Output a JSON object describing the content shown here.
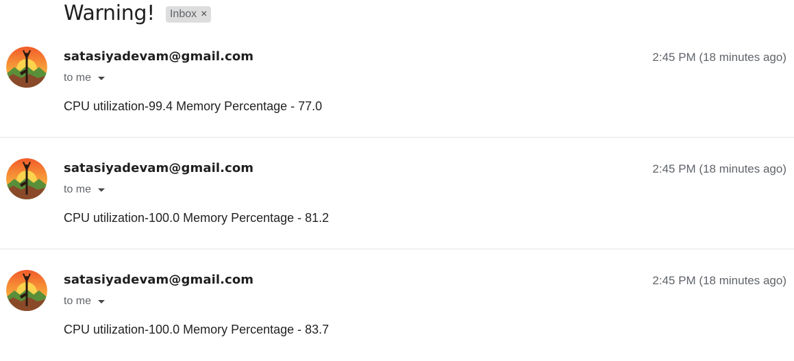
{
  "thread": {
    "subject": "Warning!",
    "label": "Inbox",
    "label_remove_glyph": "×"
  },
  "messages": [
    {
      "sender": "satasiyadevam@gmail.com",
      "recipient": "to me",
      "time": "2:45 PM (18 minutes ago)",
      "body": "CPU utilization-99.4 Memory Percentage - 77.0"
    },
    {
      "sender": "satasiyadevam@gmail.com",
      "recipient": "to me",
      "time": "2:45 PM (18 minutes ago)",
      "body": "CPU utilization-100.0 Memory Percentage - 81.2"
    },
    {
      "sender": "satasiyadevam@gmail.com",
      "recipient": "to me",
      "time": "2:45 PM (18 minutes ago)",
      "body": "CPU utilization-100.0 Memory Percentage - 83.7"
    }
  ],
  "icons": {
    "avatar": "yoga-tree-pose-sunset-avatar",
    "recipient_toggle": "caret-down-icon",
    "label_remove": "close-icon"
  }
}
